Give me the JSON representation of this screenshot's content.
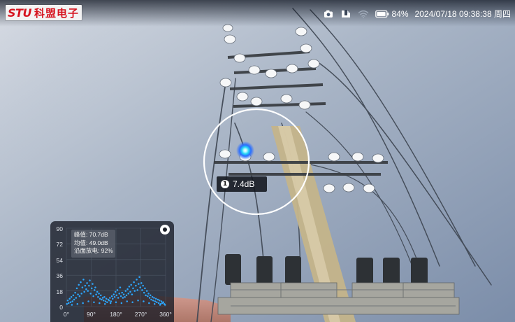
{
  "brand": {
    "logo_mark": "STU",
    "logo_text": "科盟电子"
  },
  "status_bar": {
    "battery_percent": "84%",
    "datetime": "2024/07/18 09:38:38 周四",
    "icons": [
      "camera-icon",
      "media-folder-icon",
      "wifi-icon",
      "battery-icon"
    ]
  },
  "detection": {
    "badge": "1",
    "value": "7.4dB",
    "marker_color": "#27d6f5"
  },
  "prpd_panel": {
    "stats": {
      "peak": "峰值: 70.7dB",
      "avg": "均值: 49.0dB",
      "discharge": "沿面放电: 92%"
    },
    "colors": {
      "points": "#2da7ff",
      "grid": "#4b5563"
    }
  },
  "chart_data": {
    "type": "scatter",
    "xlabel": "",
    "ylabel": "",
    "xlim": [
      0,
      360
    ],
    "ylim": [
      0,
      90
    ],
    "x_ticks": [
      "0°",
      "90°",
      "180°",
      "270°",
      "360°"
    ],
    "y_ticks": [
      "90",
      "72",
      "54",
      "36",
      "18",
      "0"
    ],
    "points": [
      [
        2,
        3
      ],
      [
        5,
        7
      ],
      [
        8,
        4
      ],
      [
        12,
        9
      ],
      [
        15,
        5
      ],
      [
        18,
        11
      ],
      [
        22,
        6
      ],
      [
        25,
        13
      ],
      [
        28,
        8
      ],
      [
        32,
        16
      ],
      [
        35,
        10
      ],
      [
        38,
        21
      ],
      [
        42,
        14
      ],
      [
        45,
        25
      ],
      [
        48,
        12
      ],
      [
        52,
        28
      ],
      [
        55,
        15
      ],
      [
        58,
        22
      ],
      [
        62,
        31
      ],
      [
        65,
        17
      ],
      [
        68,
        24
      ],
      [
        72,
        20
      ],
      [
        75,
        27
      ],
      [
        78,
        18
      ],
      [
        82,
        24
      ],
      [
        85,
        30
      ],
      [
        88,
        15
      ],
      [
        92,
        21
      ],
      [
        95,
        26
      ],
      [
        98,
        12
      ],
      [
        102,
        19
      ],
      [
        105,
        22
      ],
      [
        108,
        14
      ],
      [
        112,
        17
      ],
      [
        115,
        11
      ],
      [
        118,
        15
      ],
      [
        122,
        9
      ],
      [
        125,
        13
      ],
      [
        128,
        8
      ],
      [
        132,
        10
      ],
      [
        135,
        7
      ],
      [
        138,
        11
      ],
      [
        142,
        6
      ],
      [
        145,
        9
      ],
      [
        148,
        5
      ],
      [
        152,
        8
      ],
      [
        155,
        7
      ],
      [
        158,
        10
      ],
      [
        162,
        6
      ],
      [
        165,
        12
      ],
      [
        168,
        9
      ],
      [
        172,
        14
      ],
      [
        175,
        11
      ],
      [
        178,
        17
      ],
      [
        182,
        13
      ],
      [
        185,
        19
      ],
      [
        188,
        10
      ],
      [
        192,
        15
      ],
      [
        195,
        22
      ],
      [
        198,
        12
      ],
      [
        202,
        16
      ],
      [
        205,
        10
      ],
      [
        208,
        14
      ],
      [
        212,
        11
      ],
      [
        215,
        18
      ],
      [
        218,
        13
      ],
      [
        222,
        20
      ],
      [
        225,
        15
      ],
      [
        228,
        23
      ],
      [
        232,
        17
      ],
      [
        235,
        25
      ],
      [
        238,
        14
      ],
      [
        242,
        21
      ],
      [
        245,
        28
      ],
      [
        248,
        18
      ],
      [
        252,
        24
      ],
      [
        255,
        31
      ],
      [
        258,
        19
      ],
      [
        262,
        26
      ],
      [
        265,
        34
      ],
      [
        268,
        22
      ],
      [
        272,
        27
      ],
      [
        275,
        19
      ],
      [
        278,
        24
      ],
      [
        282,
        16
      ],
      [
        285,
        21
      ],
      [
        288,
        13
      ],
      [
        292,
        18
      ],
      [
        295,
        12
      ],
      [
        298,
        15
      ],
      [
        302,
        10
      ],
      [
        305,
        13
      ],
      [
        308,
        8
      ],
      [
        312,
        11
      ],
      [
        315,
        7
      ],
      [
        318,
        10
      ],
      [
        322,
        6
      ],
      [
        325,
        9
      ],
      [
        328,
        5
      ],
      [
        332,
        8
      ],
      [
        335,
        4
      ],
      [
        338,
        7
      ],
      [
        342,
        3
      ],
      [
        345,
        6
      ],
      [
        348,
        4
      ],
      [
        352,
        5
      ],
      [
        355,
        3
      ],
      [
        358,
        2
      ],
      [
        20,
        2
      ],
      [
        40,
        3
      ],
      [
        60,
        4
      ],
      [
        80,
        6
      ],
      [
        100,
        5
      ],
      [
        120,
        4
      ],
      [
        140,
        3
      ],
      [
        160,
        4
      ],
      [
        180,
        5
      ],
      [
        200,
        4
      ],
      [
        220,
        6
      ],
      [
        240,
        5
      ],
      [
        260,
        7
      ],
      [
        280,
        6
      ],
      [
        300,
        4
      ],
      [
        320,
        3
      ],
      [
        340,
        2
      ]
    ]
  }
}
